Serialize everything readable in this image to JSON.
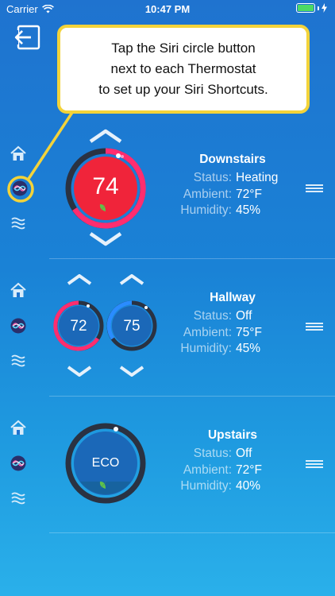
{
  "status_bar": {
    "carrier": "Carrier",
    "time": "10:47 PM"
  },
  "callout": {
    "lines": [
      "Tap the Siri circle button",
      "next to each Thermostat",
      "to set up your Siri Shortcuts."
    ],
    "border_color": "#f3d33a"
  },
  "labels": {
    "status": "Status:",
    "ambient": "Ambient:",
    "humidity": "Humidity:"
  },
  "thermostats": [
    {
      "name": "Downstairs",
      "status": "Heating",
      "ambient": "72°F",
      "humidity": "45%",
      "setpoint": "74"
    },
    {
      "name": "Hallway",
      "status": "Off",
      "ambient": "75°F",
      "humidity": "45%",
      "heat_setpoint": "72",
      "cool_setpoint": "75"
    },
    {
      "name": "Upstairs",
      "status": "Off",
      "ambient": "72°F",
      "humidity": "40%",
      "mode": "ECO"
    }
  ],
  "colors": {
    "heat": "#ff2d6f",
    "cool": "#2a8cff",
    "eco_leaf": "#5fc24a",
    "siri_highlight": "#f3d33a"
  },
  "icons": [
    "back-arrow-icon",
    "home-icon",
    "siri-icon",
    "chevron-up-icon",
    "chevron-down-icon",
    "leaf-icon",
    "reorder-handle-icon",
    "wifi-icon",
    "battery-icon",
    "charging-icon"
  ]
}
